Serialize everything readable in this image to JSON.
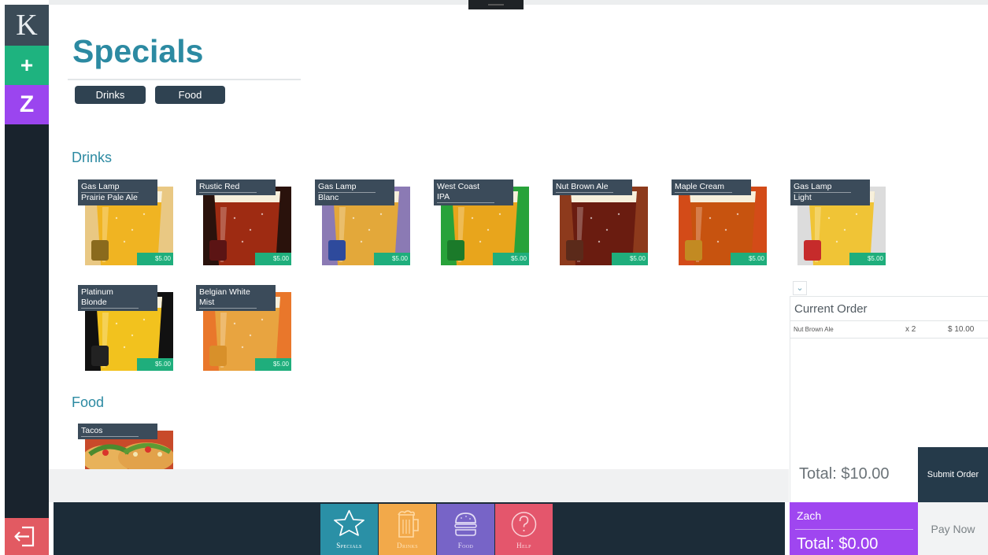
{
  "rail": {
    "logo_letter": "K",
    "add_label": "+",
    "user_initial": "Z",
    "colors": {
      "add": "#1eb37f",
      "user": "#9b45ef",
      "exit": "#e25a62"
    }
  },
  "page": {
    "title": "Specials"
  },
  "filters": [
    {
      "label": "Drinks"
    },
    {
      "label": "Food"
    }
  ],
  "sections": {
    "drinks": "Drinks",
    "food": "Food"
  },
  "drinks": [
    {
      "name_l1": "Gas Lamp",
      "name_l2": "Prairie Pale Ale",
      "price": "$5.00",
      "beer_color": "#f0b422",
      "bg": "#e9c883",
      "logo_color": "#8a6a1d"
    },
    {
      "name_l1": "Rustic Red",
      "name_l2": "",
      "price": "$5.00",
      "beer_color": "#9e2b12",
      "bg": "#2a120c",
      "logo_color": "#5b1414"
    },
    {
      "name_l1": "Gas Lamp",
      "name_l2": "Blanc",
      "price": "$5.00",
      "beer_color": "#e3a83a",
      "bg": "#8b7ab4",
      "logo_color": "#2e4a9c"
    },
    {
      "name_l1": "West Coast IPA",
      "name_l2": "",
      "price": "$5.00",
      "beer_color": "#e8a51c",
      "bg": "#28a23a",
      "logo_color": "#1b7a2a"
    },
    {
      "name_l1": "Nut Brown Ale",
      "name_l2": "",
      "price": "$5.00",
      "beer_color": "#6a1c10",
      "bg": "#8d3a1c",
      "logo_color": "#5b2a1a"
    },
    {
      "name_l1": "Maple Cream",
      "name_l2": "",
      "price": "$5.00",
      "beer_color": "#c7530f",
      "bg": "#d34b18",
      "logo_color": "#c28a22"
    },
    {
      "name_l1": "Gas Lamp",
      "name_l2": "Light",
      "price": "$5.00",
      "beer_color": "#f0c436",
      "bg": "#dcdcdc",
      "logo_color": "#c62b2b"
    },
    {
      "name_l1": "Platinum Blonde",
      "name_l2": "",
      "price": "$5.00",
      "beer_color": "#f2c21e",
      "bg": "#111111",
      "logo_color": "#222222"
    },
    {
      "name_l1": "Belgian White Mist",
      "name_l2": "",
      "price": "$5.00",
      "beer_color": "#e8a440",
      "bg": "#e9772b",
      "logo_color": "#d8902a"
    }
  ],
  "food": [
    {
      "name_l1": "Tacos",
      "name_l2": ""
    }
  ],
  "nav": [
    {
      "label": "Specials",
      "color": "#2a90a6",
      "icon": "star-icon"
    },
    {
      "label": "Drinks",
      "color": "#f2a94a",
      "icon": "beer-mug-icon"
    },
    {
      "label": "Food",
      "color": "#7764c7",
      "icon": "burger-icon"
    },
    {
      "label": "Help",
      "color": "#e4566c",
      "icon": "question-icon"
    }
  ],
  "order": {
    "caret": "⌄",
    "title": "Current Order",
    "items": [
      {
        "name": "Nut Brown Ale",
        "qty": "x 2",
        "price": "$ 10.00"
      }
    ],
    "total": "Total: $10.00",
    "submit_label": "Submit Order",
    "user_name": "Zach",
    "user_total": "Total: $0.00",
    "pay_label": "Pay Now"
  }
}
